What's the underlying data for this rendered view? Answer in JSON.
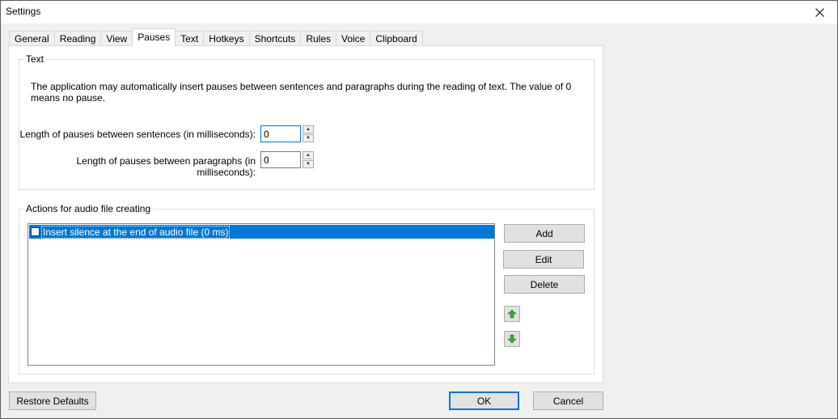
{
  "window": {
    "title": "Settings"
  },
  "tabs": [
    "General",
    "Reading",
    "View",
    "Pauses",
    "Text",
    "Hotkeys",
    "Shortcuts",
    "Rules",
    "Voice",
    "Clipboard"
  ],
  "active_tab": "Pauses",
  "text_group": {
    "legend": "Text",
    "description": "The application may automatically insert pauses between sentences and paragraphs during the reading of text. The value of 0 means no pause.",
    "sentences_label": "Length of pauses between sentences (in milliseconds):",
    "sentences_value": "0",
    "paragraphs_label": "Length of pauses between paragraphs (in milliseconds):",
    "paragraphs_value": "0"
  },
  "audio_group": {
    "legend": "Actions for audio file creating",
    "items": [
      {
        "label": "Insert silence at the end of audio file (0 ms)",
        "checked": false,
        "selected": true
      }
    ],
    "add_label": "Add",
    "edit_label": "Edit",
    "delete_label": "Delete"
  },
  "footer": {
    "restore_label": "Restore Defaults",
    "ok_label": "OK",
    "cancel_label": "Cancel"
  },
  "colors": {
    "selection": "#0078d7",
    "arrow_green": "#3aa63a"
  },
  "icons": {
    "close": "close-icon",
    "up": "arrow-up-icon",
    "down": "arrow-down-icon"
  }
}
